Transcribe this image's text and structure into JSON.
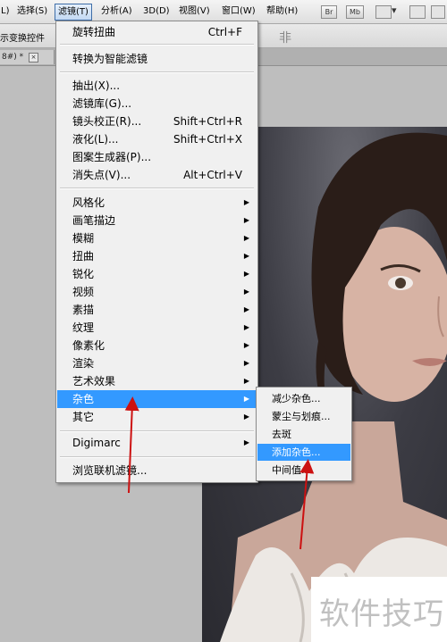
{
  "menubar": {
    "items": [
      {
        "label": "L)"
      },
      {
        "label": "选择(S)"
      },
      {
        "label": "滤镜(T)"
      },
      {
        "label": "分析(A)"
      },
      {
        "label": "3D(D)"
      },
      {
        "label": "视图(V)"
      },
      {
        "label": "窗口(W)"
      },
      {
        "label": "帮助(H)"
      }
    ],
    "br_label": "Br",
    "mb_label": "Mb"
  },
  "optionbar": {
    "transform_controls_label": "示变换控件"
  },
  "document_tab": {
    "label": "8#) *",
    "close_glyph": "×"
  },
  "filter_menu": {
    "items": [
      {
        "label": "旋转扭曲",
        "shortcut": "Ctrl+F"
      },
      {
        "label": "转换为智能滤镜"
      },
      {
        "label": "抽出(X)..."
      },
      {
        "label": "滤镜库(G)..."
      },
      {
        "label": "镜头校正(R)...",
        "shortcut": "Shift+Ctrl+R"
      },
      {
        "label": "液化(L)...",
        "shortcut": "Shift+Ctrl+X"
      },
      {
        "label": "图案生成器(P)..."
      },
      {
        "label": "消失点(V)...",
        "shortcut": "Alt+Ctrl+V"
      },
      {
        "label": "风格化"
      },
      {
        "label": "画笔描边"
      },
      {
        "label": "模糊"
      },
      {
        "label": "扭曲"
      },
      {
        "label": "锐化"
      },
      {
        "label": "视频"
      },
      {
        "label": "素描"
      },
      {
        "label": "纹理"
      },
      {
        "label": "像素化"
      },
      {
        "label": "渲染"
      },
      {
        "label": "艺术效果"
      },
      {
        "label": "杂色"
      },
      {
        "label": "其它"
      },
      {
        "label": "Digimarc"
      },
      {
        "label": "浏览联机滤镜..."
      }
    ],
    "submenu_arrow": "▶"
  },
  "noise_submenu": {
    "items": [
      {
        "label": "减少杂色..."
      },
      {
        "label": "蒙尘与划痕..."
      },
      {
        "label": "去斑"
      },
      {
        "label": "添加杂色..."
      },
      {
        "label": "中间值..."
      }
    ]
  },
  "watermark": {
    "text": "软件技巧"
  },
  "colors": {
    "highlight": "#3399ff",
    "annotation_arrow": "#cc1111"
  }
}
